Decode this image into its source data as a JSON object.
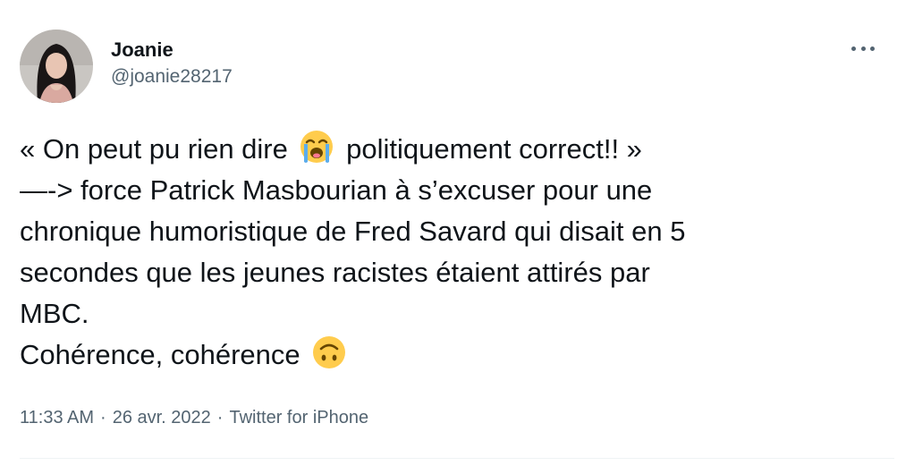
{
  "author": {
    "display_name": "Joanie",
    "handle": "@joanie28217"
  },
  "tweet": {
    "lines": [
      {
        "before": "« On peut pu rien dire ",
        "emoji": "loudly-crying-face-icon",
        "after": " politiquement correct!! »"
      },
      {
        "text": "—-> force Patrick Masbourian à s’excuser pour une"
      },
      {
        "text": "chronique humoristique de Fred Savard qui disait en 5"
      },
      {
        "text": "secondes que les jeunes racistes étaient attirés par"
      },
      {
        "text": "MBC."
      },
      {
        "before": "Cohérence, cohérence ",
        "emoji": "upside-down-face-icon",
        "after": ""
      }
    ]
  },
  "meta": {
    "time": "11:33 AM",
    "separator": "·",
    "date": "26 avr. 2022",
    "source": "Twitter for iPhone"
  },
  "colors": {
    "text": "#0f1419",
    "secondary": "#536471",
    "emoji_yellow": "#FFCC4D",
    "tear_blue": "#5DADEC"
  }
}
